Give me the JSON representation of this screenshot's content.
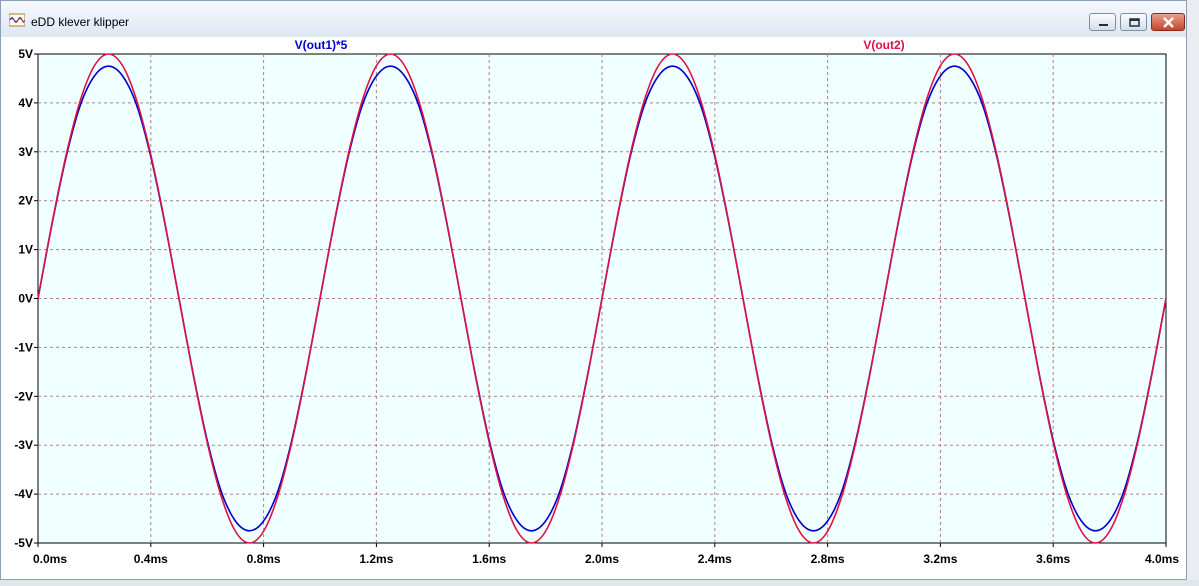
{
  "window": {
    "title": "eDD klever klipper",
    "icon": "waveform-icon",
    "controls": [
      "minimize-icon",
      "maximize-icon",
      "close-icon"
    ]
  },
  "colors": {
    "plot_background": "#f0ffff",
    "grid": "#b08080",
    "axis_text": "#000000",
    "series_out1": "#0000cc",
    "series_out2": "#dd1144"
  },
  "chart_data": {
    "type": "line",
    "title": "",
    "xlabel": "",
    "ylabel": "",
    "grid": true,
    "xlim": [
      0,
      4
    ],
    "ylim": [
      -5,
      5
    ],
    "x_ticks": [
      0,
      0.4,
      0.8,
      1.2,
      1.6,
      2.0,
      2.4,
      2.8,
      3.2,
      3.6,
      4.0
    ],
    "y_ticks": [
      5,
      4,
      3,
      2,
      1,
      0,
      -1,
      -2,
      -3,
      -4,
      -5
    ],
    "x_tick_labels": [
      "0.0ms",
      "0.4ms",
      "0.8ms",
      "1.2ms",
      "1.6ms",
      "2.0ms",
      "2.4ms",
      "2.8ms",
      "3.2ms",
      "3.6ms",
      "4.0ms"
    ],
    "y_tick_labels": [
      "5V",
      "4V",
      "3V",
      "2V",
      "1V",
      "0V",
      "-1V",
      "-2V",
      "-3V",
      "-4V",
      "-5V"
    ],
    "series": [
      {
        "name": "V(out1)*5",
        "color": "#0000cc",
        "x": [
          0,
          0.05,
          0.1,
          0.15,
          0.2,
          0.25,
          0.3,
          0.35,
          0.4,
          0.45,
          0.5,
          0.55,
          0.6,
          0.65,
          0.7,
          0.75,
          0.8,
          0.85,
          0.9,
          0.95,
          1.0,
          1.05,
          1.1,
          1.15,
          1.2,
          1.25,
          1.3,
          1.35,
          1.4,
          1.45,
          1.5,
          1.55,
          1.6,
          1.65,
          1.7,
          1.75,
          1.8,
          1.85,
          1.9,
          1.95,
          2.0,
          2.05,
          2.1,
          2.15,
          2.2,
          2.25,
          2.3,
          2.35,
          2.4,
          2.45,
          2.5,
          2.55,
          2.6,
          2.65,
          2.7,
          2.75,
          2.8,
          2.85,
          2.9,
          2.95,
          3.0,
          3.05,
          3.1,
          3.15,
          3.2,
          3.25,
          3.3,
          3.35,
          3.4,
          3.45,
          3.5,
          3.55,
          3.6,
          3.65,
          3.7,
          3.75,
          3.8,
          3.85,
          3.9,
          3.95,
          4.0
        ],
        "y": [
          0,
          1.53,
          2.9,
          3.95,
          4.55,
          4.75,
          4.55,
          3.95,
          2.9,
          1.53,
          0,
          -1.53,
          -2.9,
          -3.95,
          -4.55,
          -4.75,
          -4.55,
          -3.95,
          -2.9,
          -1.53,
          0,
          1.53,
          2.9,
          3.95,
          4.55,
          4.75,
          4.55,
          3.95,
          2.9,
          1.53,
          0,
          -1.53,
          -2.9,
          -3.95,
          -4.55,
          -4.75,
          -4.55,
          -3.95,
          -2.9,
          -1.53,
          0,
          1.53,
          2.9,
          3.95,
          4.55,
          4.75,
          4.55,
          3.95,
          2.9,
          1.53,
          0,
          -1.53,
          -2.9,
          -3.95,
          -4.55,
          -4.75,
          -4.55,
          -3.95,
          -2.9,
          -1.53,
          0,
          1.53,
          2.9,
          3.95,
          4.55,
          4.75,
          4.55,
          3.95,
          2.9,
          1.53,
          0,
          -1.53,
          -2.9,
          -3.95,
          -4.55,
          -4.75,
          -4.55,
          -3.95,
          -2.9,
          -1.53,
          0
        ]
      },
      {
        "name": "V(out2)",
        "color": "#dd1144",
        "x": [
          0,
          0.05,
          0.1,
          0.15,
          0.2,
          0.25,
          0.3,
          0.35,
          0.4,
          0.45,
          0.5,
          0.55,
          0.6,
          0.65,
          0.7,
          0.75,
          0.8,
          0.85,
          0.9,
          0.95,
          1.0,
          1.05,
          1.1,
          1.15,
          1.2,
          1.25,
          1.3,
          1.35,
          1.4,
          1.45,
          1.5,
          1.55,
          1.6,
          1.65,
          1.7,
          1.75,
          1.8,
          1.85,
          1.9,
          1.95,
          2.0,
          2.05,
          2.1,
          2.15,
          2.2,
          2.25,
          2.3,
          2.35,
          2.4,
          2.45,
          2.5,
          2.55,
          2.6,
          2.65,
          2.7,
          2.75,
          2.8,
          2.85,
          2.9,
          2.95,
          3.0,
          3.05,
          3.1,
          3.15,
          3.2,
          3.25,
          3.3,
          3.35,
          3.4,
          3.45,
          3.5,
          3.55,
          3.6,
          3.65,
          3.7,
          3.75,
          3.8,
          3.85,
          3.9,
          3.95,
          4.0
        ],
        "y": [
          0,
          1.55,
          2.94,
          4.05,
          4.76,
          5.0,
          4.76,
          4.05,
          2.94,
          1.55,
          0,
          -1.55,
          -2.94,
          -4.05,
          -4.76,
          -5.0,
          -4.76,
          -4.05,
          -2.94,
          -1.55,
          0,
          1.55,
          2.94,
          4.05,
          4.76,
          5.0,
          4.76,
          4.05,
          2.94,
          1.55,
          0,
          -1.55,
          -2.94,
          -4.05,
          -4.76,
          -5.0,
          -4.76,
          -4.05,
          -2.94,
          -1.55,
          0,
          1.55,
          2.94,
          4.05,
          4.76,
          5.0,
          4.76,
          4.05,
          2.94,
          1.55,
          0,
          -1.55,
          -2.94,
          -4.05,
          -4.76,
          -5.0,
          -4.76,
          -4.05,
          -2.94,
          -1.55,
          0,
          1.55,
          2.94,
          4.05,
          4.76,
          5.0,
          4.76,
          4.05,
          2.94,
          1.55,
          0,
          -1.55,
          -2.94,
          -4.05,
          -4.76,
          -5.0,
          -4.76,
          -4.05,
          -2.94,
          -1.55,
          0
        ]
      }
    ]
  }
}
